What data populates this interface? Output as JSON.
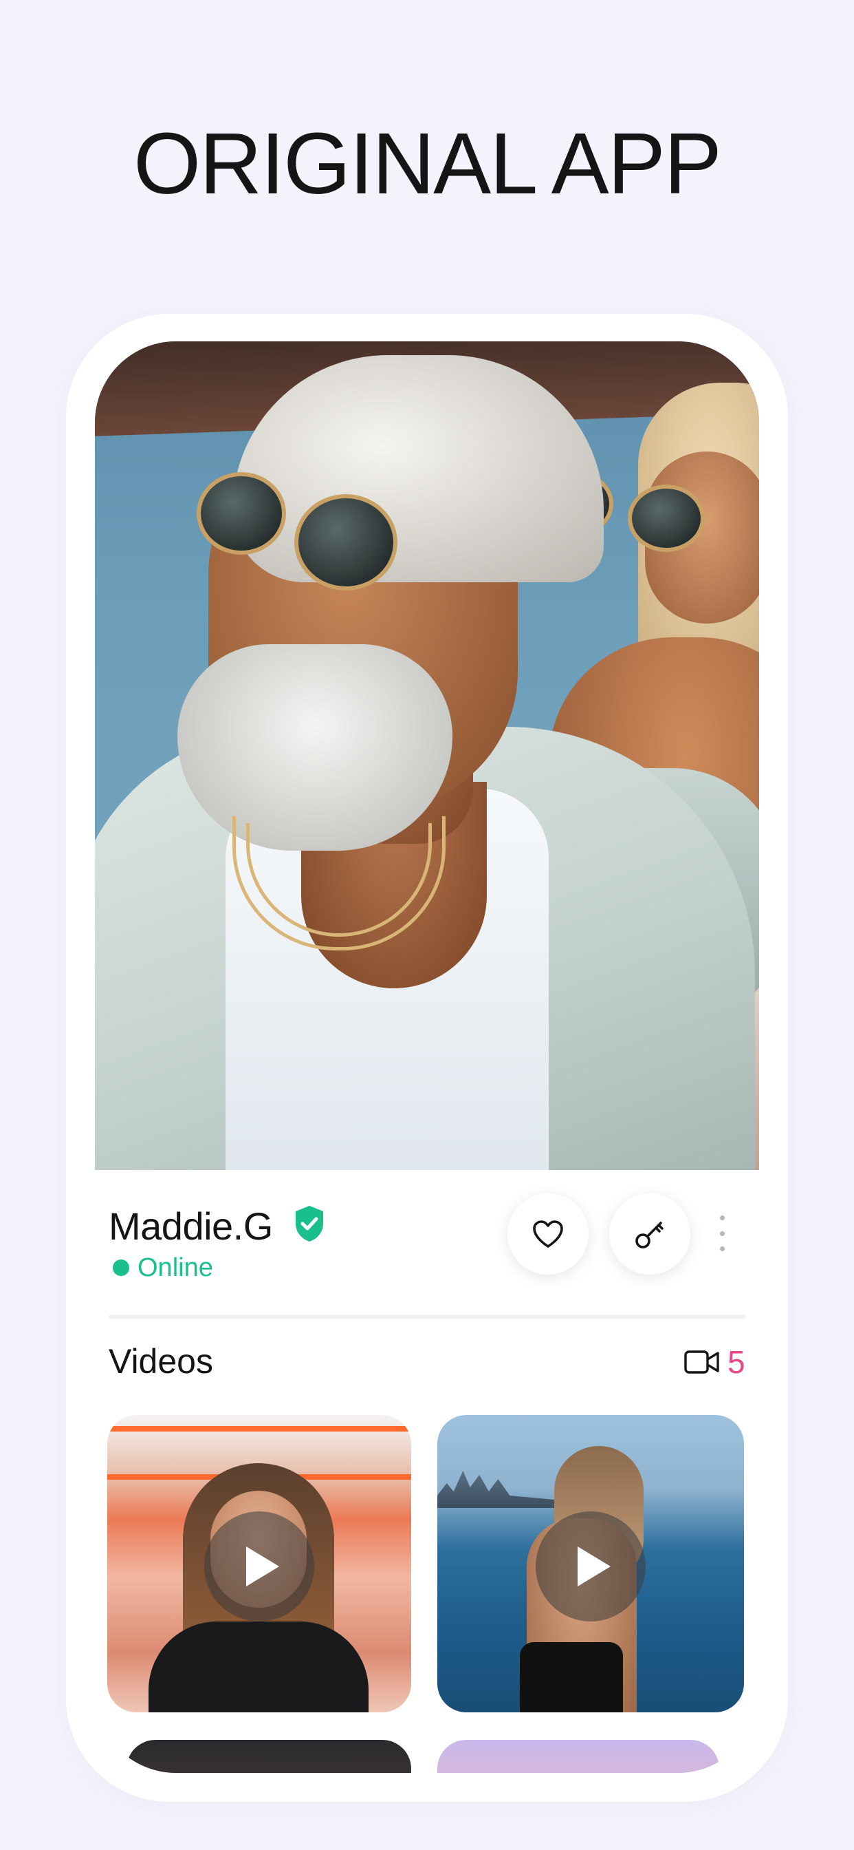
{
  "heading": "ORIGINAL APP",
  "profile": {
    "name": "Maddie.G",
    "status": "Online",
    "verified_icon": "verified-shield-icon"
  },
  "actions": {
    "like_icon": "heart-icon",
    "key_icon": "key-icon",
    "more_icon": "more-vertical-icon"
  },
  "videos": {
    "title": "Videos",
    "count": "5",
    "count_icon": "video-camera-icon",
    "tiles": [
      {
        "icon": "play-icon"
      },
      {
        "icon": "play-icon"
      }
    ]
  },
  "colors": {
    "accent_green": "#19c08c",
    "count_pink": "#e8478a",
    "background": "#f3f3fc"
  }
}
